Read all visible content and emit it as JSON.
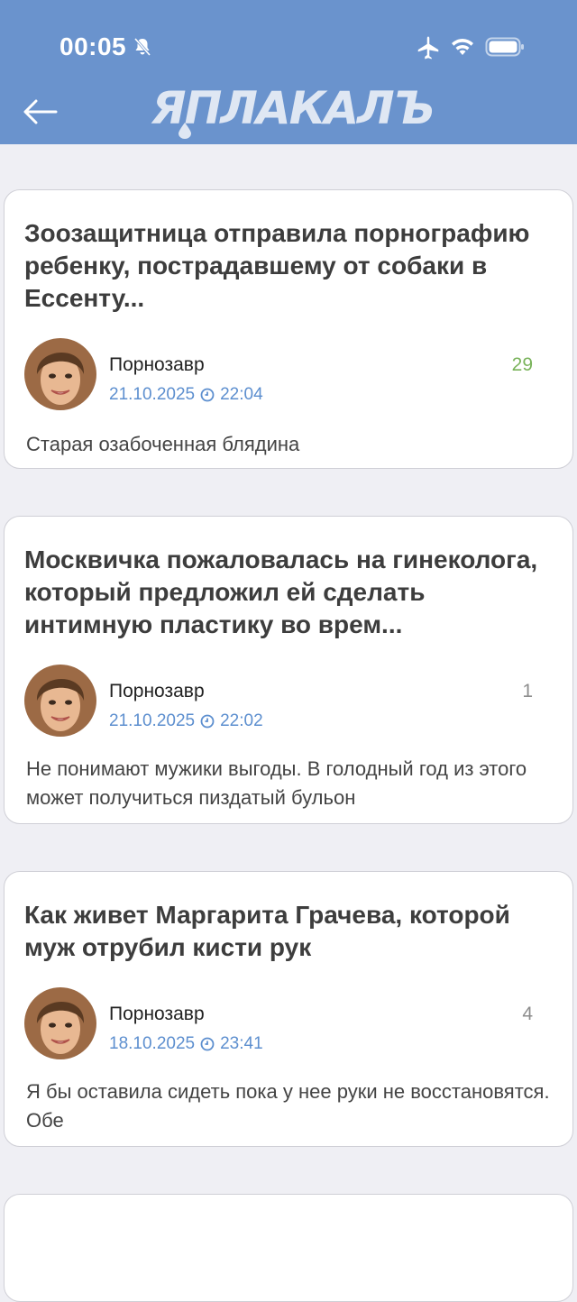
{
  "status_bar": {
    "time": "00:05"
  },
  "header": {
    "logo_text": "ЯПЛАКАЛЪ",
    "brand_color": "#6a93cd"
  },
  "posts": [
    {
      "title": "Зоозащитница отправила порнографию ребенку, пострадавшему от собаки в Ессенту...",
      "author": "Порнозавр",
      "date": "21.10.2025",
      "time": "22:04",
      "count": "29",
      "snippet": "Старая озабоченная блядина"
    },
    {
      "title": "Москвичка пожаловалась на гинеколога, который предложил ей сделать интимную пластику во врем...",
      "author": "Порнозавр",
      "date": "21.10.2025",
      "time": "22:02",
      "count": "1",
      "snippet": "Не понимают мужики выгоды. В голодный год из этого может получиться пиздатый бульон"
    },
    {
      "title": "Как живет Маргарита Грачева, которой муж отрубил кисти рук",
      "author": "Порнозавр",
      "date": "18.10.2025",
      "time": "23:41",
      "count": "4",
      "snippet": "Я бы оставила сидеть пока у нее руки не восстановятся. Обе"
    }
  ]
}
